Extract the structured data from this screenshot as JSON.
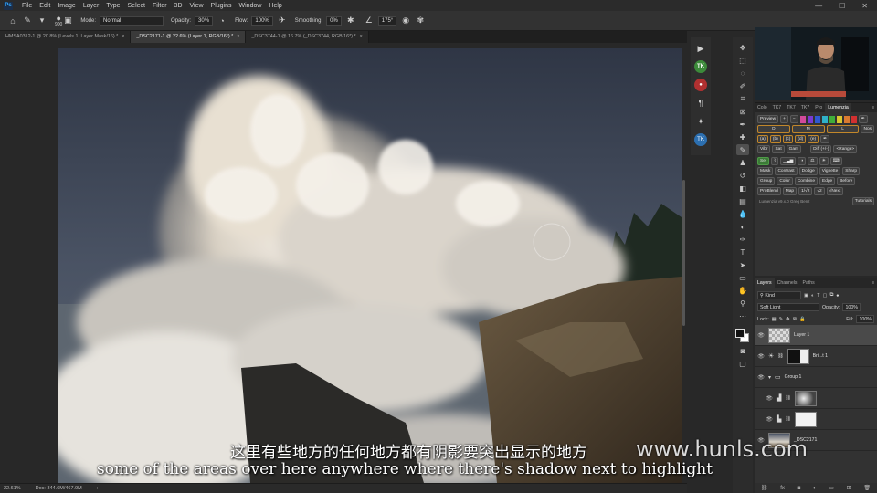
{
  "app": {
    "logo": "Ps"
  },
  "menu": [
    "File",
    "Edit",
    "Image",
    "Layer",
    "Type",
    "Select",
    "Filter",
    "3D",
    "View",
    "Plugins",
    "Window",
    "Help"
  ],
  "options": {
    "brush_size": "900",
    "mode_label": "Mode:",
    "mode_value": "Normal",
    "opacity_label": "Opacity:",
    "opacity_value": "30%",
    "flow_label": "Flow:",
    "flow_value": "100%",
    "smoothing_label": "Smoothing:",
    "smoothing_value": "0%",
    "angle_value": "175°"
  },
  "tabs": [
    {
      "label": "HMSA0312-1 @ 20.8% (Levels 1, Layer Mask/16) *"
    },
    {
      "label": "_DSC2171-1 @ 22.6% (Layer 1, RGB/16*) *"
    },
    {
      "label": "_DSC3744-1 @ 16.7% (_DSC3744, RGB/16*) *"
    }
  ],
  "status": {
    "zoom": "22.61%",
    "doc": "Doc: 344.6M/467.9M"
  },
  "lumenzia": {
    "tabs": [
      "Colo",
      "TK7",
      "TK7",
      "TK7",
      "Pro",
      "Lumenzia"
    ],
    "preview_label": "Preview",
    "zone_row": [
      "D",
      "M",
      "L"
    ],
    "dark_row": [
      "(a)",
      "(b)",
      "(c)",
      "(d)",
      "(e)"
    ],
    "nos_label": "Nos",
    "mid_row": [
      "Vibr",
      "Sat",
      "Gam"
    ],
    "diff_label": "Diff (+/-)",
    "range_label": "<Range>",
    "sel_label": "Sel",
    "action_row1": [
      "Mask",
      "Contrast",
      "Dodge",
      "Vignette",
      "Sharp"
    ],
    "action_row2": [
      "Group",
      "Color",
      "Combine",
      "Edge",
      "Before"
    ],
    "action_row3": [
      "ProBlend",
      "Map",
      "1/√2",
      "√2",
      "√Next"
    ],
    "footer": "Lumenzia v9.x.0 Greg Benz",
    "tutorials_label": "Tutorials"
  },
  "layers": {
    "tabs": [
      "Layers",
      "Channels",
      "Paths"
    ],
    "kind_label": "Kind",
    "blend_mode": "Soft Light",
    "opacity_label": "Opacity:",
    "opacity_value": "100%",
    "lock_label": "Lock:",
    "fill_label": "Fill:",
    "fill_value": "100%",
    "items": [
      {
        "name": "Layer 1"
      },
      {
        "name": "Bri...t 1"
      },
      {
        "name": "Group 1"
      },
      {
        "name": ""
      },
      {
        "name": ""
      },
      {
        "name": "_DSC2171"
      }
    ]
  },
  "subtitles": {
    "chinese": "这里有些地方的任何地方都有阴影要突出显示的地方",
    "english": "some of the areas over here anywhere where there's shadow next to highlight",
    "watermark": "www.hunls.com"
  },
  "colors": {
    "accent_orange": "#c2872a",
    "lumenzia_green": "#3b7a36",
    "sky": "#3e4a5c"
  }
}
